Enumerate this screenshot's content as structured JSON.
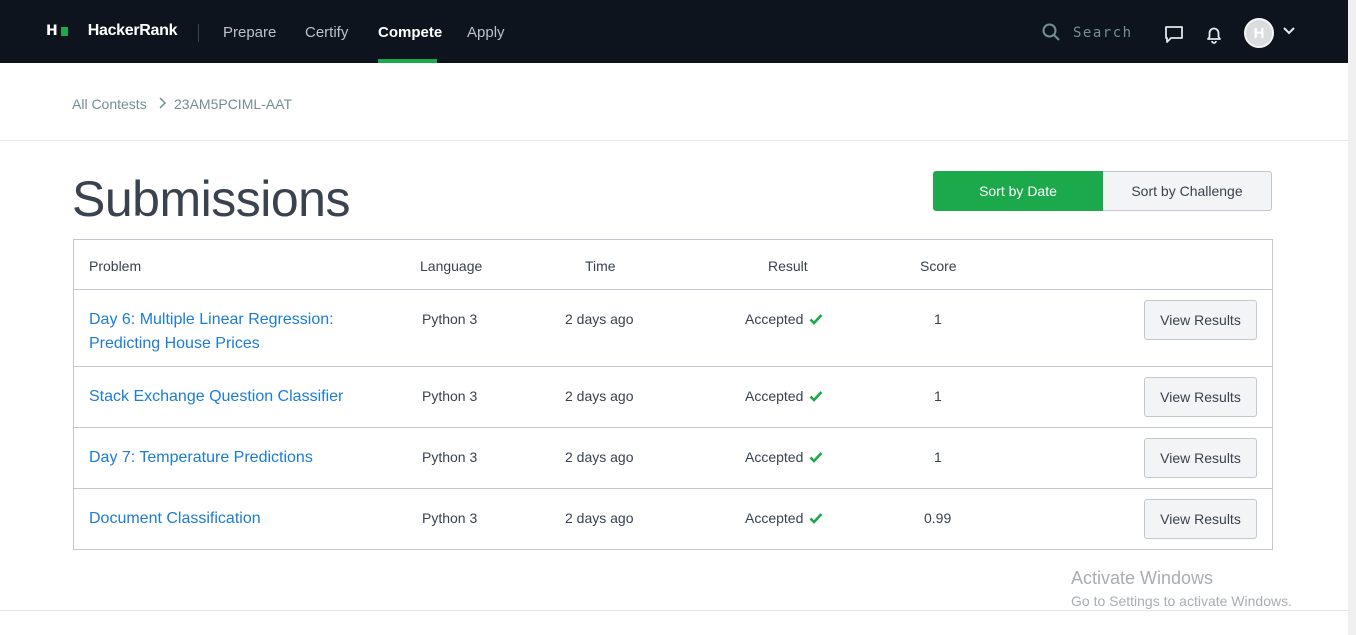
{
  "nav": {
    "logo_glyph": "H",
    "brand": "HackerRank",
    "items": [
      "Prepare",
      "Certify",
      "Compete",
      "Apply"
    ],
    "active": "Compete",
    "search_placeholder": "Search",
    "avatar_letter": "H"
  },
  "breadcrumb": {
    "root": "All Contests",
    "current": "23AM5PCIML-AAT"
  },
  "page": {
    "title": "Submissions",
    "sort_by_date": "Sort by Date",
    "sort_by_challenge": "Sort by Challenge"
  },
  "table": {
    "headers": [
      "Problem",
      "Language",
      "Time",
      "Result",
      "Score"
    ],
    "rows": [
      {
        "problem": "Day 6: Multiple Linear Regression: Predicting House Prices",
        "language": "Python 3",
        "time": "2 days ago",
        "result": "Accepted",
        "score": "1",
        "action": "View Results"
      },
      {
        "problem": "Stack Exchange Question Classifier",
        "language": "Python 3",
        "time": "2 days ago",
        "result": "Accepted",
        "score": "1",
        "action": "View Results"
      },
      {
        "problem": "Day 7: Temperature Predictions",
        "language": "Python 3",
        "time": "2 days ago",
        "result": "Accepted",
        "score": "1",
        "action": "View Results"
      },
      {
        "problem": "Document Classification",
        "language": "Python 3",
        "time": "2 days ago",
        "result": "Accepted",
        "score": "0.99",
        "action": "View Results"
      }
    ]
  },
  "watermark": {
    "line1": "Activate Windows",
    "line2": "Go to Settings to activate Windows."
  },
  "colors": {
    "brand_green": "#1ba94c",
    "nav_bg": "#0e141e",
    "link_blue": "#1c7cd6"
  }
}
